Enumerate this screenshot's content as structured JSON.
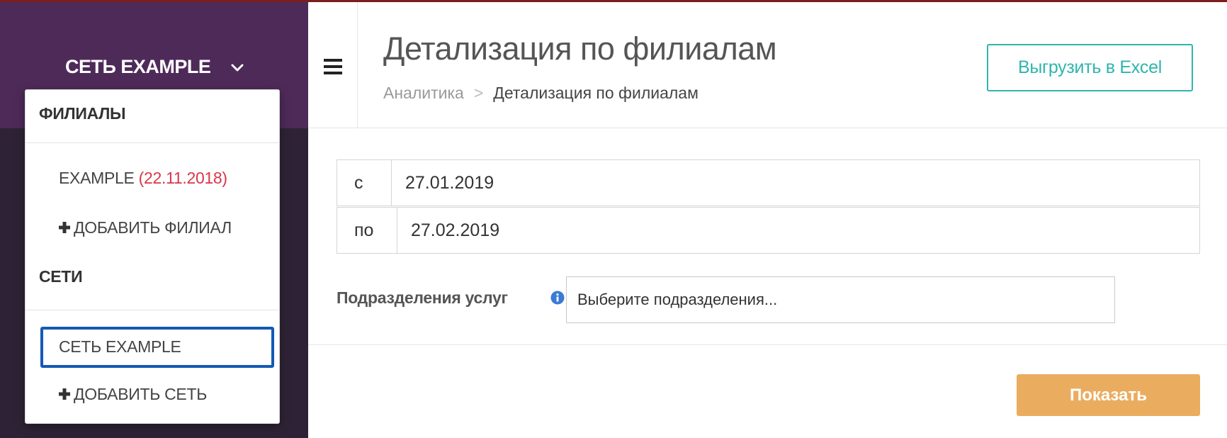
{
  "sidebar": {
    "network_title": "СЕТЬ EXAMPLE",
    "chevron_icon": "chevron-down-icon"
  },
  "dropdown": {
    "branches_heading": "ФИЛИАЛЫ",
    "branch_name": "EXAMPLE",
    "branch_date": "(22.11.2018)",
    "add_branch_label": "ДОБАВИТЬ ФИЛИАЛ",
    "networks_heading": "СЕТИ",
    "network_item": "СЕТЬ EXAMPLE",
    "add_network_label": "ДОБАВИТЬ СЕТЬ",
    "plus_icon": "plus-icon"
  },
  "header": {
    "menu_icon": "hamburger-menu-icon",
    "title": "Детализация по филиалам",
    "breadcrumb": {
      "parent": "Аналитика",
      "separator": ">",
      "current": "Детализация по филиалам"
    },
    "export_label": "Выгрузить в Excel"
  },
  "filters": {
    "from_label": "с",
    "from_value": "27.01.2019",
    "to_label": "по",
    "to_value": "27.02.2019",
    "services_label": "Подразделения услуг",
    "services_info_icon": "info-icon",
    "services_placeholder": "Выберите подразделения..."
  },
  "actions": {
    "show_label": "Показать"
  },
  "colors": {
    "sidebar_bg": "#2e2336",
    "sidebar_header_bg": "#4e2a59",
    "accent_teal": "#2fb5ad",
    "show_button": "#eaad60",
    "branch_date": "#d9364a",
    "active_outline": "#1459b5"
  }
}
